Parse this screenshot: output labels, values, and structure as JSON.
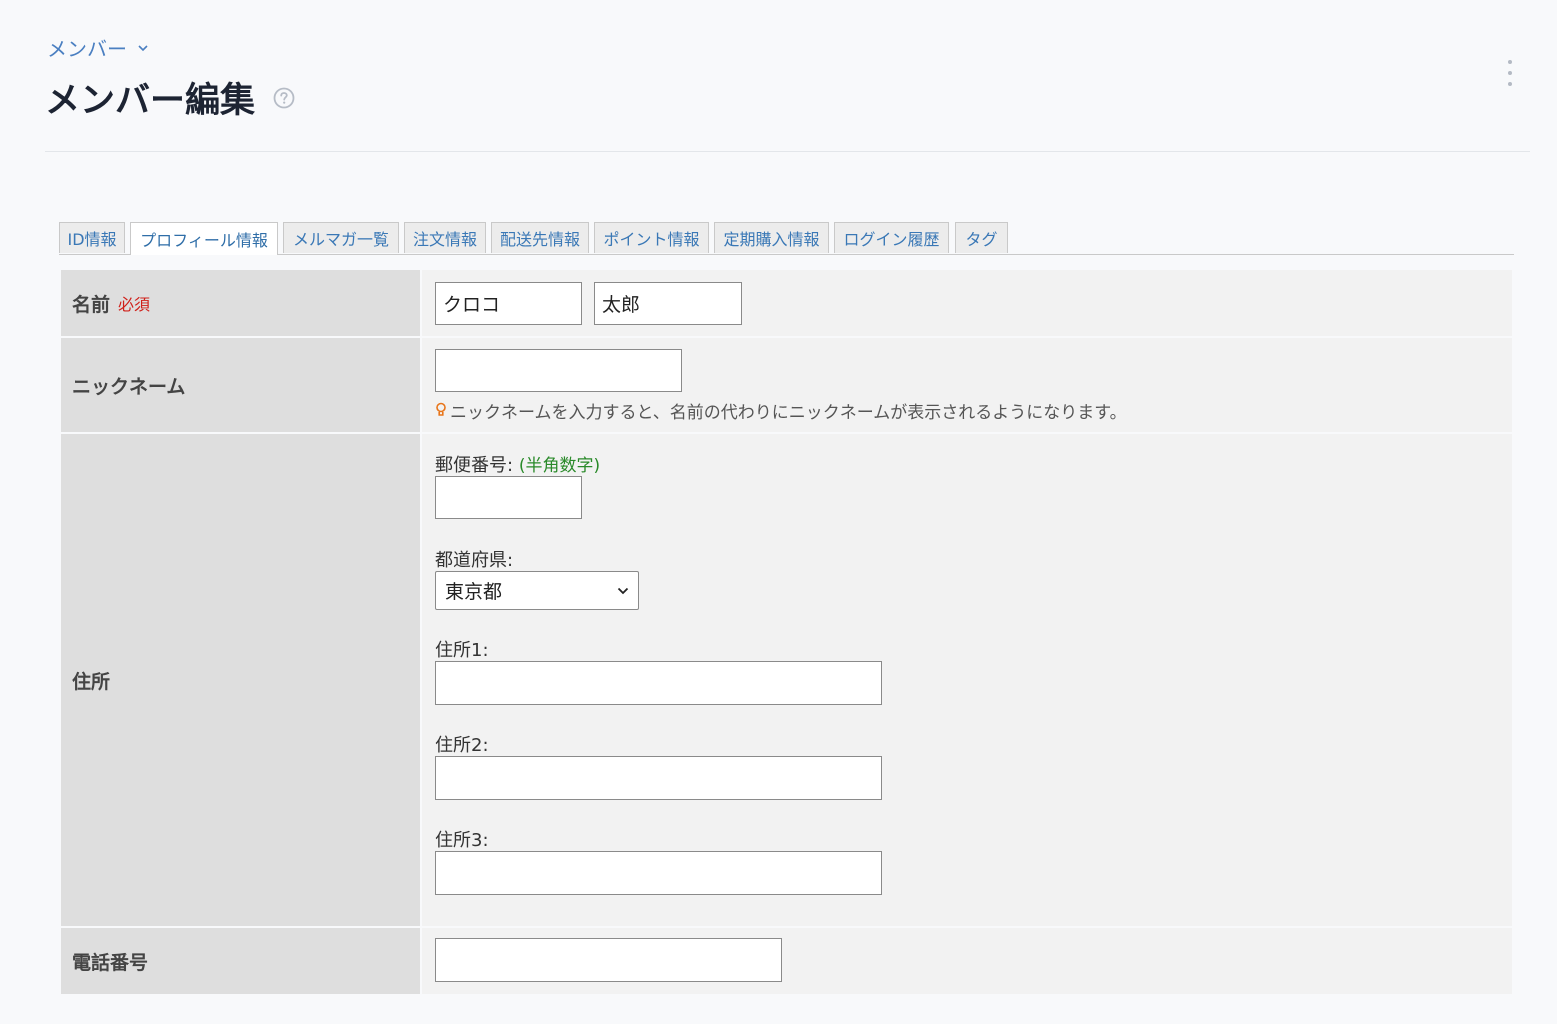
{
  "breadcrumb": {
    "label": "メンバー"
  },
  "page": {
    "title": "メンバー編集"
  },
  "tabs": [
    {
      "label": "ID情報",
      "active": false
    },
    {
      "label": "プロフィール情報",
      "active": true
    },
    {
      "label": "メルマガ一覧",
      "active": false
    },
    {
      "label": "注文情報",
      "active": false
    },
    {
      "label": "配送先情報",
      "active": false
    },
    {
      "label": "ポイント情報",
      "active": false
    },
    {
      "label": "定期購入情報",
      "active": false
    },
    {
      "label": "ログイン履歴",
      "active": false
    },
    {
      "label": "タグ",
      "active": false
    }
  ],
  "form": {
    "name": {
      "label": "名前",
      "required": "必須",
      "last_name": "クロコ",
      "first_name": "太郎"
    },
    "nickname": {
      "label": "ニックネーム",
      "value": "",
      "hint": "ニックネームを入力すると、名前の代わりにニックネームが表示されるようになります。"
    },
    "address": {
      "label": "住所",
      "postal_label": "郵便番号:",
      "postal_note": "(半角数字)",
      "postal_value": "",
      "prefecture_label": "都道府県:",
      "prefecture_value": "東京都",
      "address1_label": "住所1:",
      "address1_value": "",
      "address2_label": "住所2:",
      "address2_value": "",
      "address3_label": "住所3:",
      "address3_value": ""
    },
    "phone": {
      "label": "電話番号",
      "value": ""
    }
  },
  "colors": {
    "accent": "#3a78b6",
    "required": "#d0211b",
    "note": "#2a8a2a",
    "hint_icon": "#e8751a"
  }
}
